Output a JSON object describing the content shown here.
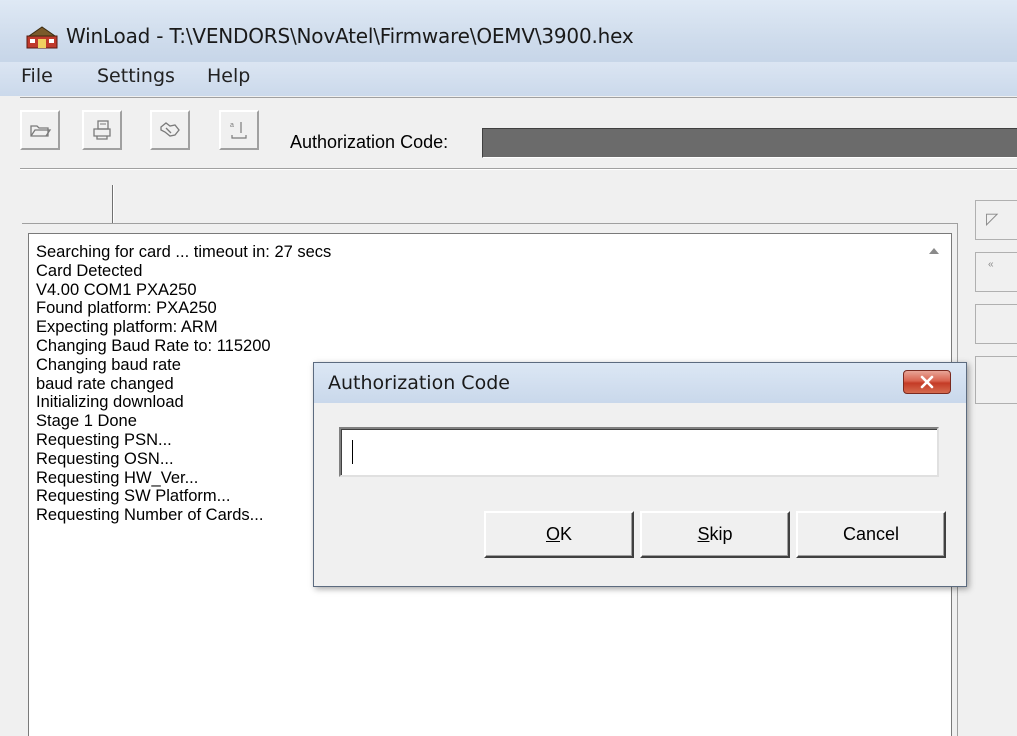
{
  "window": {
    "title": "WinLoad - T:\\VENDORS\\NovAtel\\Firmware\\OEMV\\3900.hex",
    "app_icon": "winload-app-icon"
  },
  "menu": {
    "items": [
      "File",
      "Settings",
      "Help"
    ]
  },
  "toolbar": {
    "buttons": [
      "open-folder-icon",
      "print-icon",
      "authorize-icon",
      "erase-icon"
    ],
    "auth_label": "Authorization Code:"
  },
  "log": {
    "lines": [
      "Searching for card ... timeout in: 27 secs",
      "Card Detected",
      "V4.00 COM1 PXA250",
      "Found platform: PXA250",
      "Expecting platform: ARM",
      "Changing Baud Rate to: 115200",
      "Changing baud rate",
      "baud rate changed",
      "Initializing download",
      "Stage 1 Done",
      "Requesting PSN...",
      "Requesting OSN...",
      "Requesting HW_Ver...",
      "Requesting SW Platform...",
      "Requesting Number of Cards..."
    ]
  },
  "dialog": {
    "title": "Authorization Code",
    "input_value": "",
    "ok_label": "OK",
    "ok_mnemonic": "O",
    "ok_rest": "K",
    "skip_label": "Skip",
    "skip_mnemonic": "S",
    "skip_rest": "kip",
    "cancel_label": "Cancel"
  },
  "colors": {
    "close_button": "#c43b26",
    "auth_field_bg": "#6b6b6b"
  }
}
